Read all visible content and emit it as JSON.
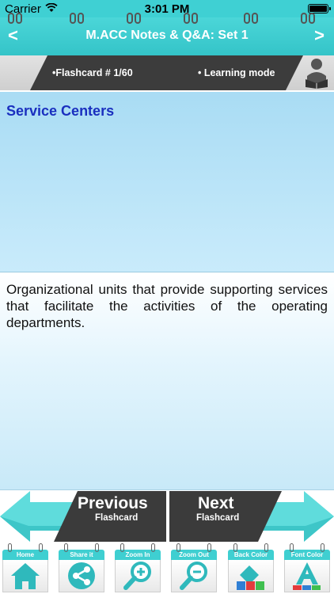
{
  "status_bar": {
    "carrier": "Carrier",
    "time": "3:01 PM"
  },
  "nav": {
    "back": "<",
    "title": "M.ACC Notes & Q&A: Set 1",
    "forward": ">"
  },
  "info": {
    "flashcard": "•Flashcard #  1/60",
    "mode": "• Learning mode"
  },
  "card": {
    "question": "Service Centers",
    "answer": "Organizational units that provide supporting services that facilitate the activities of the operating departments."
  },
  "buttons": {
    "previous_main": "Previous",
    "previous_sub": "Flashcard",
    "next_main": "Next",
    "next_sub": "Flashcard"
  },
  "toolbar": [
    {
      "label": "Home",
      "icon": "home-icon"
    },
    {
      "label": "Share it",
      "icon": "share-icon"
    },
    {
      "label": "Zoom In",
      "icon": "zoom-in-icon"
    },
    {
      "label": "Zoom Out",
      "icon": "zoom-out-icon"
    },
    {
      "label": "Back Color",
      "icon": "paint-bucket-icon"
    },
    {
      "label": "Font Color",
      "icon": "font-color-icon"
    }
  ],
  "colors": {
    "accent": "#3fd0d3",
    "question_text": "#1a2fbf",
    "dark_panel": "#3c3c3c"
  }
}
